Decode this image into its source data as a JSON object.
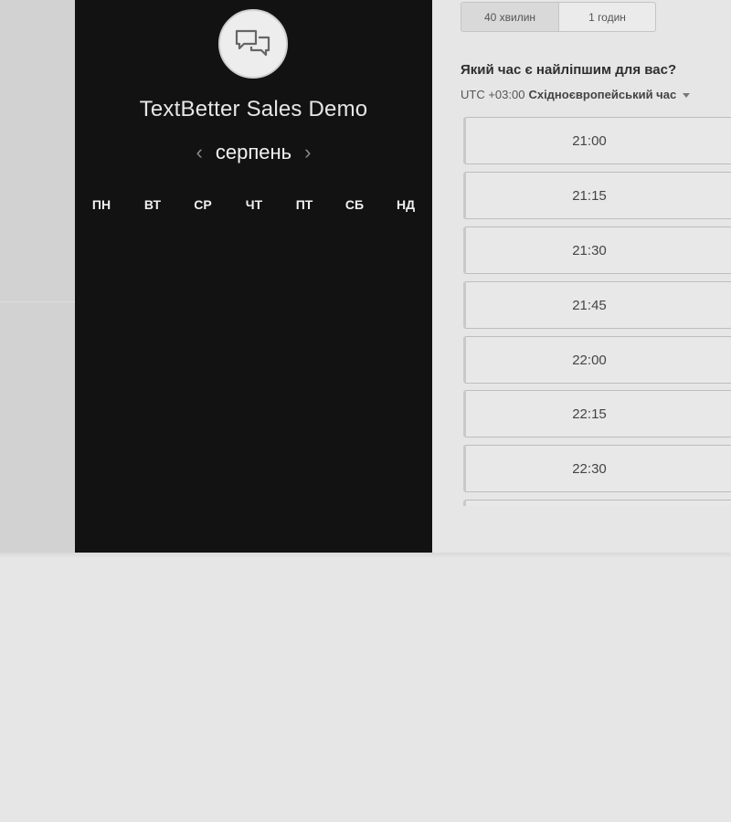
{
  "event": {
    "title": "TextBetter Sales Demo",
    "avatar_icon": "chat-bubbles-icon"
  },
  "calendar": {
    "month": "серпень",
    "prev_icon": "chevron-left-icon",
    "next_icon": "chevron-right-icon",
    "weekdays": [
      "ПН",
      "ВТ",
      "СР",
      "ЧТ",
      "ПТ",
      "СБ",
      "НД"
    ]
  },
  "durations": [
    {
      "label": "40 хвилин",
      "selected": true
    },
    {
      "label": "1 годин",
      "selected": false
    }
  ],
  "question": "Який час є найліпшим для вас?",
  "timezone": {
    "offset": "UTC +03:00",
    "name": "Східноєвропейський час",
    "caret_icon": "caret-down-icon"
  },
  "slots": [
    "21:00",
    "21:15",
    "21:30",
    "21:45",
    "22:00",
    "22:15",
    "22:30"
  ],
  "colors": {
    "panel_dark": "#121212",
    "page_bg": "#e6e6e6",
    "slot_border": "#bdbdbd"
  }
}
